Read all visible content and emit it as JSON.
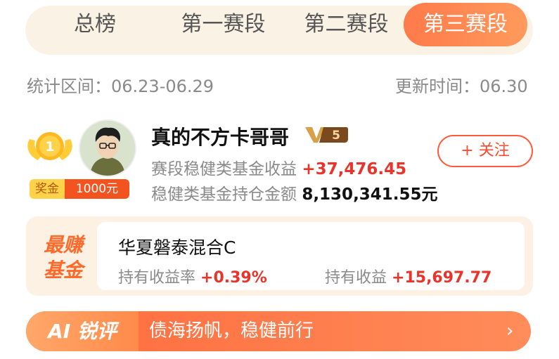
{
  "tabs": [
    {
      "label": "总榜"
    },
    {
      "label": "第一赛段"
    },
    {
      "label": "第二赛段"
    },
    {
      "label": "第三赛段"
    }
  ],
  "period": {
    "range_label": "统计区间：06.23-06.29",
    "update_label": "更新时间：06.30"
  },
  "user": {
    "rank": "1",
    "prize_key": "奖金",
    "prize_value": "1000元",
    "name": "真的不方卡哥哥",
    "level": "5",
    "follow_label": "+ 关注",
    "stage_return_label": "赛段稳健类基金收益",
    "stage_return_value": "+37,476.45",
    "holding_label": "稳健类基金持仓金额",
    "holding_value": "8,130,341.55元"
  },
  "best_fund": {
    "tag_line1": "最赚",
    "tag_line2": "基金",
    "name": "华夏磐泰混合C",
    "rate_label": "持有收益率",
    "rate_value": "+0.39%",
    "profit_label": "持有收益",
    "profit_value": "+15,697.77"
  },
  "ai_review": {
    "label": "AI 锐评",
    "text": "债海扬帆，稳健前行",
    "arrow": "›"
  },
  "colors": {
    "accent": "#ff7a4a",
    "positive": "#e8342a",
    "muted": "#8a8a8a"
  },
  "icons": {
    "medal": "gold-medal-icon",
    "badge": "level-badge-icon",
    "arrow": "chevron-right-icon"
  }
}
